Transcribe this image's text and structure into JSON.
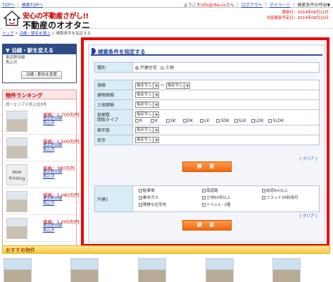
{
  "topbar": {
    "top_link": "TOPへ",
    "search_top_link": "検索TOPへ",
    "welcome_prefix": "ようこそ",
    "user": "info@rba.co",
    "welcome_suffix": "さん",
    "logout": "ログアウト",
    "mypage": "マイページ",
    "history": "検索条件の呼出▼"
  },
  "header": {
    "tagline": "安心の不動産さがし!!",
    "brand": "不動産のオオタニ",
    "updated": "更新日：2014年08月12日",
    "next_update": "次回更新予定日：2014年08月13日"
  },
  "breadcrumb": {
    "top": "トップ",
    "line_select": "沿線・駅名を選ぶ",
    "current": "検索条件を指定する"
  },
  "sidebar": {
    "line_box_title": "▼ 沿線・駅を変える",
    "line_name": "東武野田線",
    "station": "馬込沢",
    "change_button": "沿線・駅名を変更",
    "ranking_title": "物件ランキング",
    "ranking_sub": "同一エリア人気上位5件",
    "ranking": [
      {
        "price": "価格：1,700万円",
        "line": "東武野田線",
        "station": "馬込沢",
        "thumb": ""
      },
      {
        "price": "価格：1,500万円",
        "line": "東武野田線",
        "station": "馬込沢",
        "thumb": ""
      },
      {
        "price": "価格：380万円",
        "line": "東武野田線",
        "station": "馬込沢",
        "thumb": "Now Printing"
      },
      {
        "price": "価格：2,080万円",
        "line": "東武野田線",
        "station": "馬込沢",
        "thumb": ""
      },
      {
        "price": "価格：1,000万円",
        "line": "東武野田線",
        "station": "馬込沢",
        "thumb": ""
      }
    ]
  },
  "search": {
    "title": "検索条件を指定する",
    "type_label": "種別",
    "type_options": [
      "戸建住宅",
      "土地"
    ],
    "price_label": "価格",
    "price_min": "指定なし",
    "price_sep": "～",
    "price_max": "指定なし",
    "building_area_label": "建物面積",
    "building_area_value": "指定なし",
    "land_area_label": "土地面積",
    "land_area_value": "指定なし",
    "layout_label_1": "部屋数",
    "layout_label_2": "間取タイプ",
    "layout_value": "指定なし",
    "layout_types": [
      "R",
      "K",
      "SK",
      "DK",
      "LK",
      "SDK",
      "SLK",
      "LDK",
      "SLDK"
    ],
    "age_label": "築年数",
    "age_value": "指定なし",
    "walk_label": "徒歩",
    "walk_value": "指定なし",
    "clear_1": "[ クリア ]",
    "search_button_1": "検 索",
    "feature_label": "戸建1",
    "features": [
      "駐車場",
      "南道路",
      "前道6m以上",
      "都市ガス",
      "土地50坪以上",
      "フラット35利用可",
      "閑静な住宅地",
      "トイレ1・2階"
    ],
    "clear_2": "[ クリア ]",
    "search_button_2": "検 索"
  },
  "recommended": {
    "title": "おすすめ物件"
  }
}
